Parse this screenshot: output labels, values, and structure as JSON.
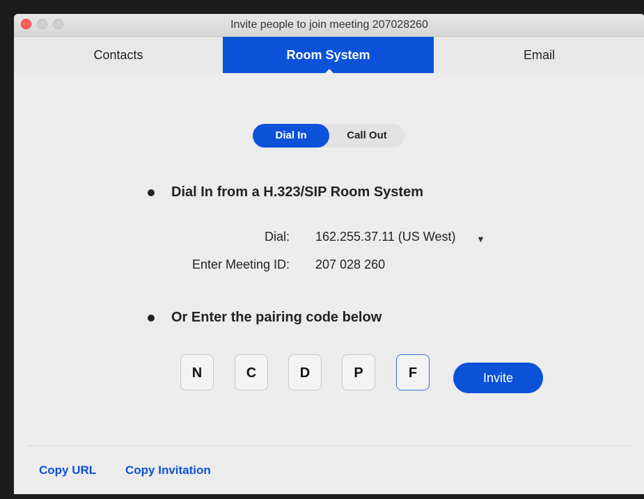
{
  "window": {
    "title": "Invite people to join meeting 207028260"
  },
  "tabs": [
    {
      "label": "Contacts",
      "active": false
    },
    {
      "label": "Room System",
      "active": true
    },
    {
      "label": "Email",
      "active": false
    }
  ],
  "mode_toggle": {
    "options": [
      "Dial In",
      "Call Out"
    ],
    "selected": "Dial In"
  },
  "section_dial_in": {
    "heading": "Dial In from a H.323/SIP Room System",
    "dial_label": "Dial:",
    "dial_value": "162.255.37.11 (US West)",
    "dropdown_icon": "▼",
    "meeting_id_label": "Enter Meeting ID:",
    "meeting_id_value": "207 028 260"
  },
  "section_pairing": {
    "heading": "Or Enter the pairing code below",
    "code": [
      "N",
      "C",
      "D",
      "P",
      "F"
    ],
    "invite_label": "Invite"
  },
  "footer": {
    "copy_url": "Copy URL",
    "copy_invitation": "Copy Invitation"
  },
  "colors": {
    "accent": "#0c52d9",
    "close_button": "#ff5f57"
  }
}
